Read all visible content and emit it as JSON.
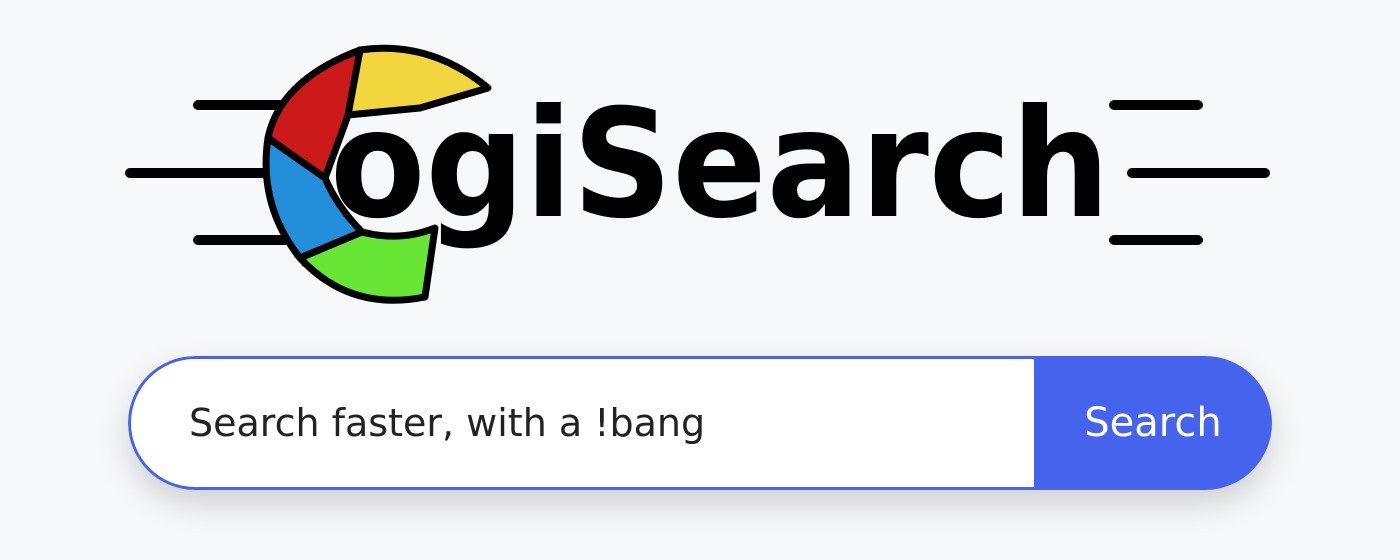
{
  "logo": {
    "wordmark": "ogiSearch",
    "colors": {
      "red": "#cc1a1a",
      "yellow": "#f2d63d",
      "blue": "#238fdb",
      "green": "#67e636",
      "outline": "#000000"
    }
  },
  "search": {
    "value": "Search faster, with a !bang",
    "button_label": "Search",
    "accent": "#4563ec"
  }
}
